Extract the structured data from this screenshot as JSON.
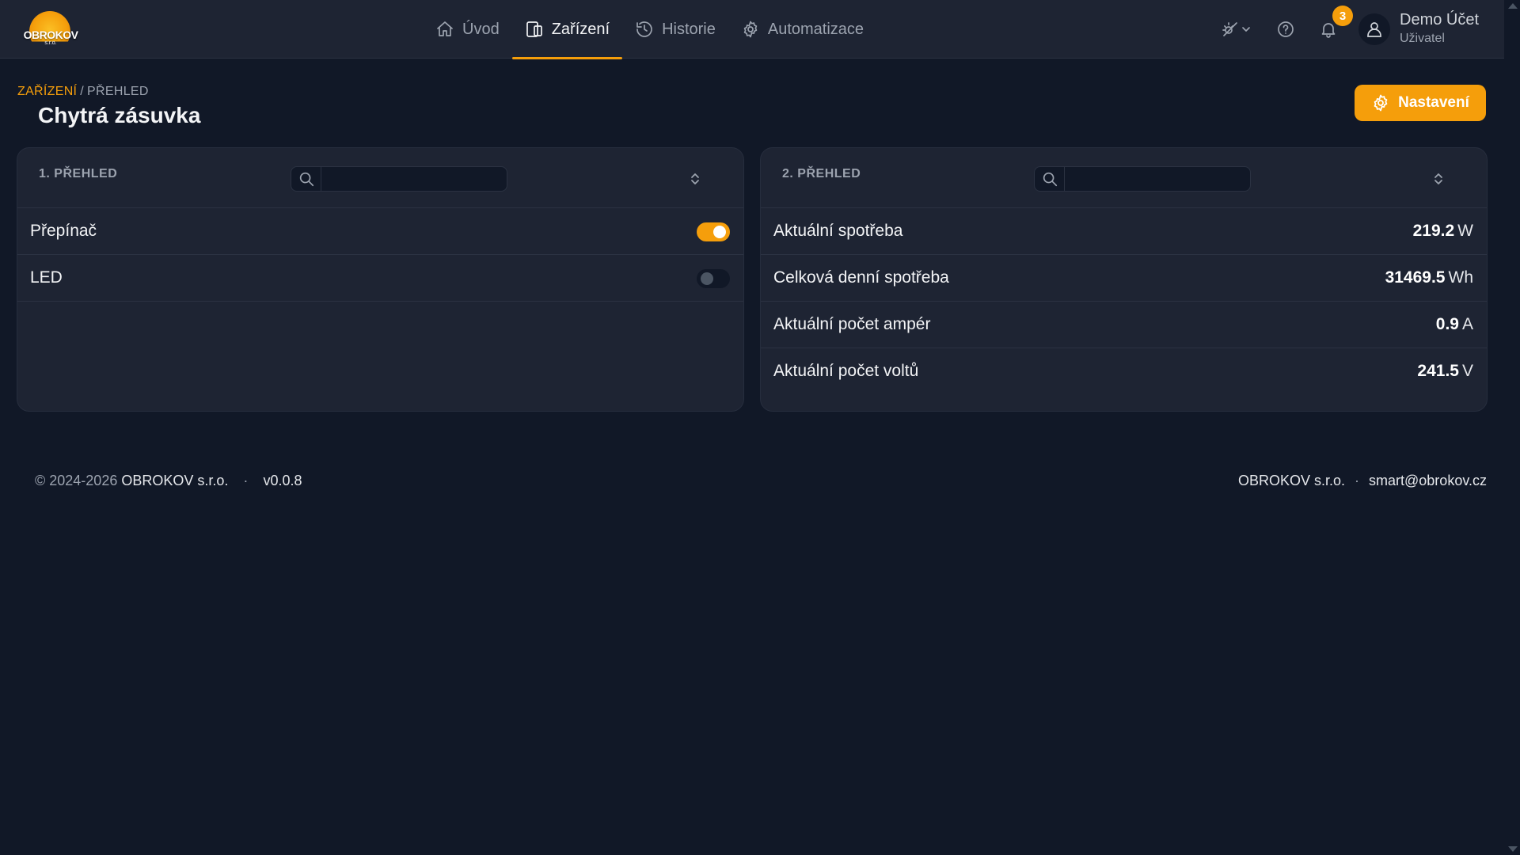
{
  "app": {
    "logo_text": "OBROKOV",
    "logo_sub": "s.r.o."
  },
  "nav": {
    "items": [
      {
        "label": "Úvod",
        "icon": "home-icon"
      },
      {
        "label": "Zařízení",
        "icon": "devices-icon",
        "active": true
      },
      {
        "label": "Historie",
        "icon": "history-icon"
      },
      {
        "label": "Automatizace",
        "icon": "gear-icon"
      }
    ]
  },
  "topbar": {
    "notification_count": "3",
    "user_name": "Demo Účet",
    "user_role": "Uživatel"
  },
  "breadcrumb": {
    "current": "ZAŘÍZENÍ",
    "separator": "/",
    "leaf": "PŘEHLED"
  },
  "page": {
    "title": "Chytrá zásuvka",
    "settings_label": "Nastavení"
  },
  "panel_left": {
    "title": "1. PŘEHLED",
    "search_value": "",
    "rows": [
      {
        "label": "Přepínač",
        "state": "on"
      },
      {
        "label": "LED",
        "state": "off"
      }
    ]
  },
  "panel_right": {
    "title": "2. PŘEHLED",
    "search_value": "",
    "rows": [
      {
        "label": "Aktuální spotřeba",
        "value": "219.2",
        "unit": "W"
      },
      {
        "label": "Celková denní spotřeba",
        "value": "31469.5",
        "unit": "Wh"
      },
      {
        "label": "Aktuální počet ampér",
        "value": "0.9",
        "unit": "A"
      },
      {
        "label": "Aktuální počet voltů",
        "value": "241.5",
        "unit": "V"
      }
    ]
  },
  "footer": {
    "copyright": "© 2024-2026",
    "brand": "OBROKOV s.r.o.",
    "separator": "·",
    "version": "v0.0.8",
    "company": "OBROKOV s.r.o.",
    "email": "smart@obrokov.cz"
  },
  "colors": {
    "accent": "#f59e0b",
    "background": "#111827",
    "surface": "#1e2433"
  }
}
